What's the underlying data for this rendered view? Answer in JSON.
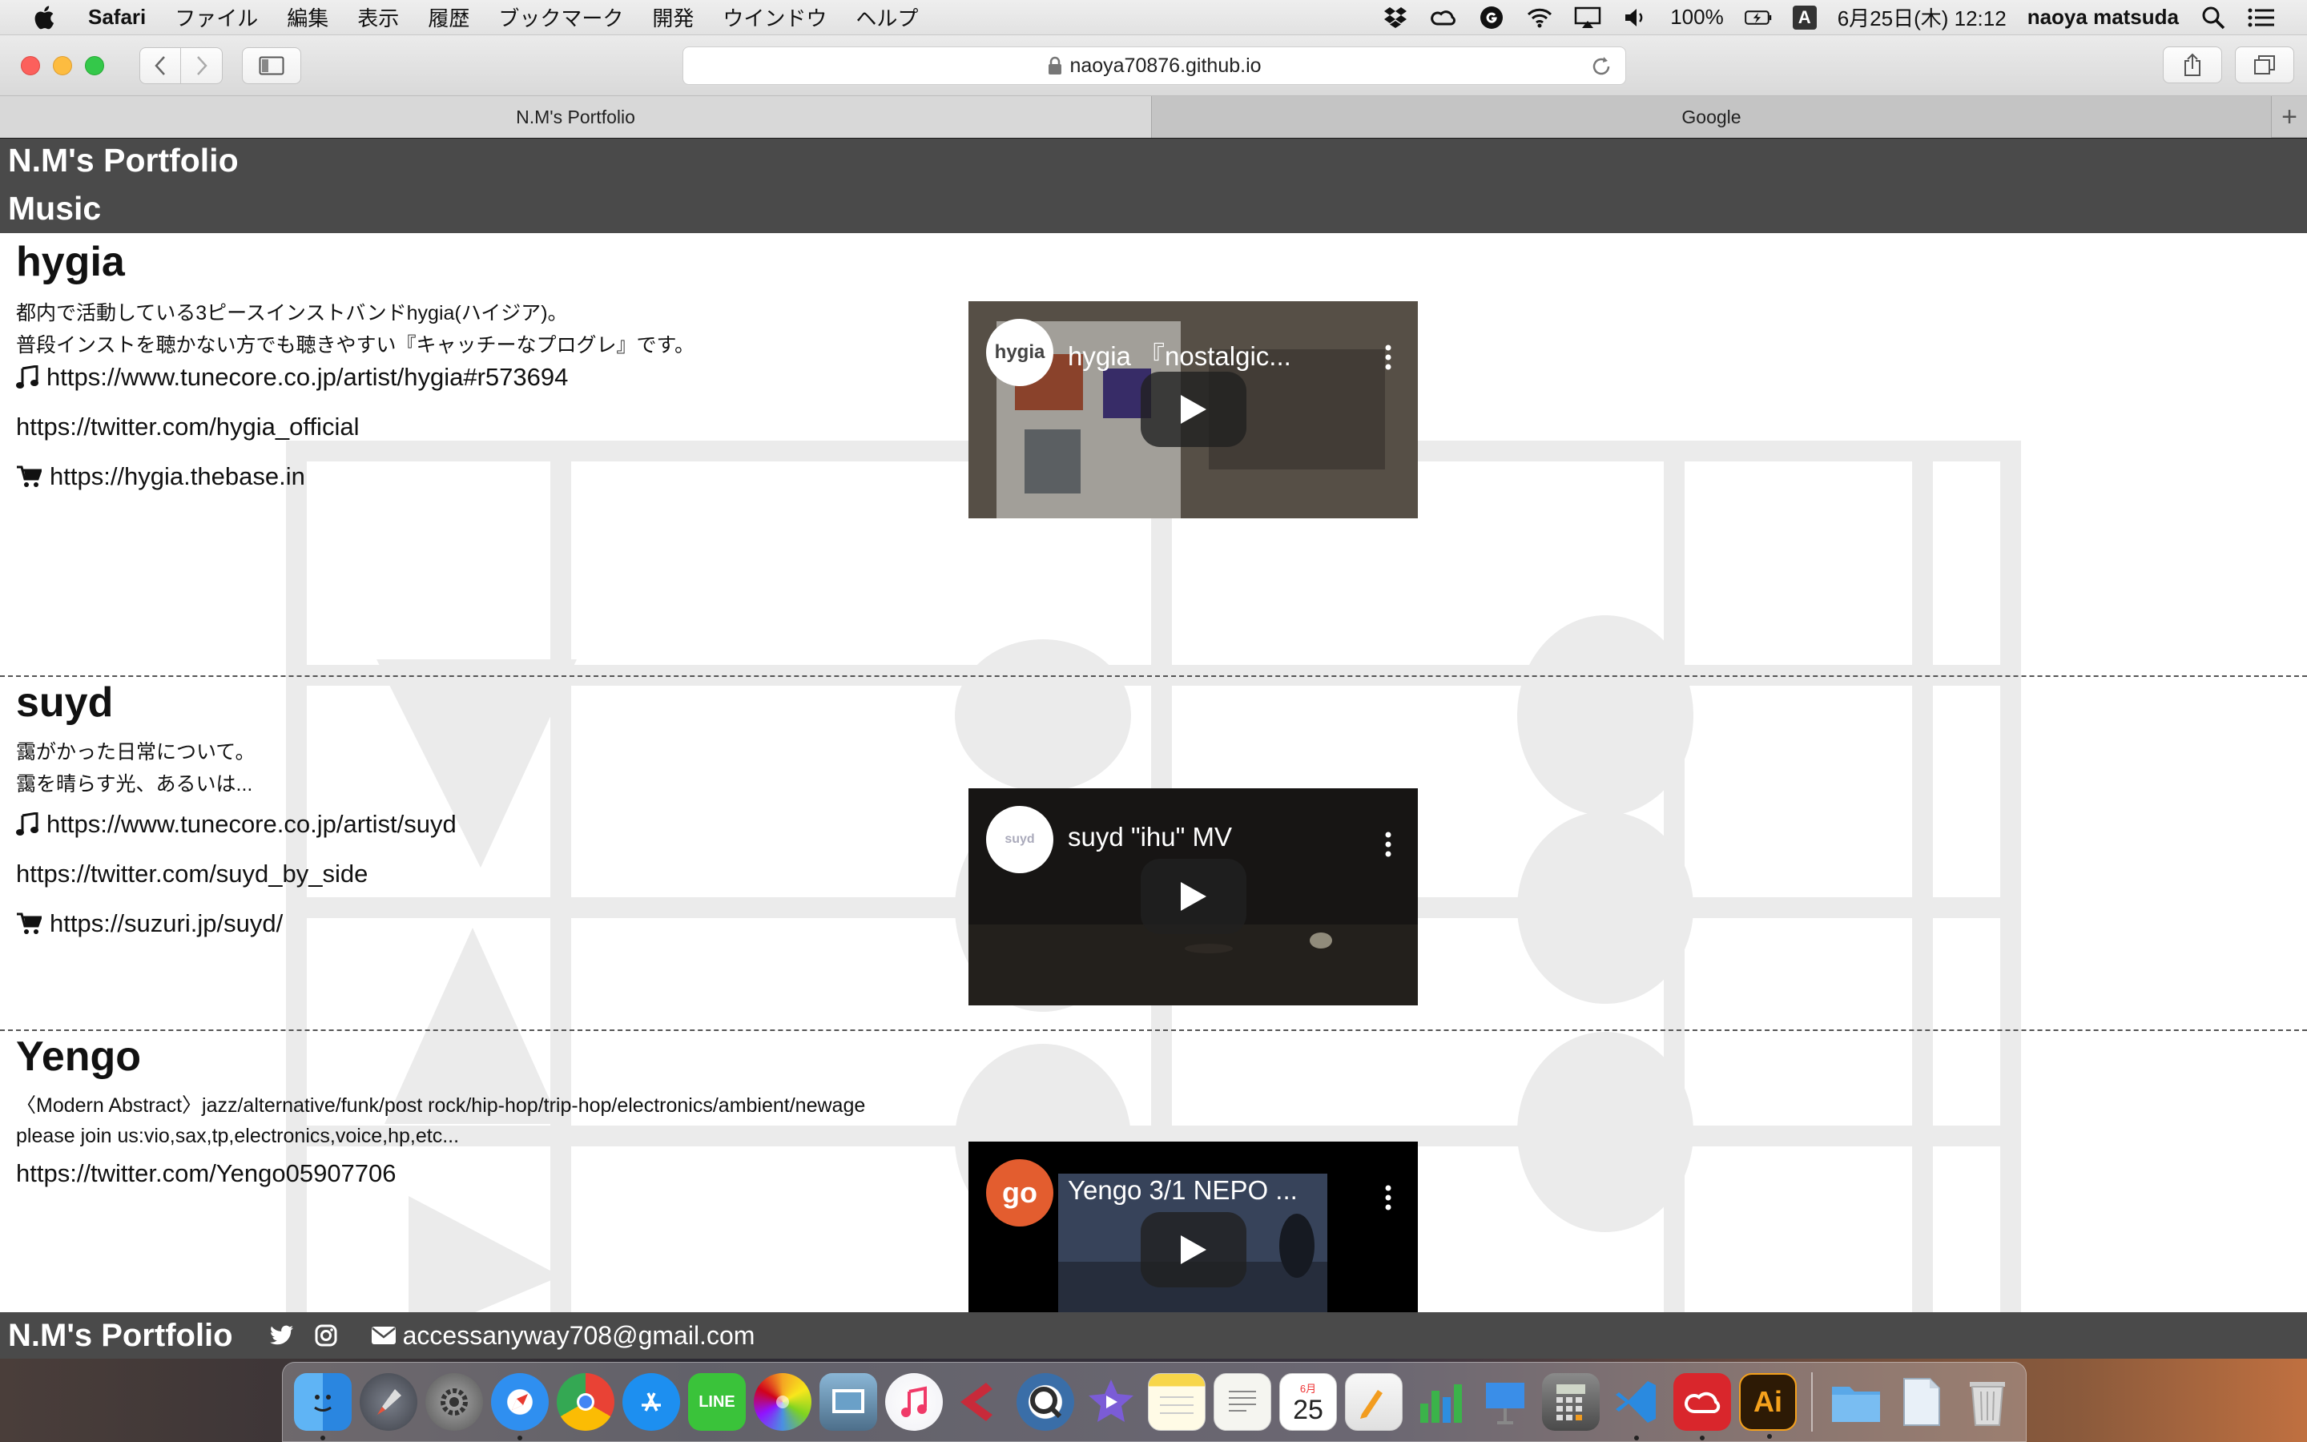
{
  "menubar": {
    "app_name": "Safari",
    "menus": [
      "ファイル",
      "編集",
      "表示",
      "履歴",
      "ブックマーク",
      "開発",
      "ウインドウ",
      "ヘルプ"
    ],
    "battery": "100%",
    "input_mode": "A",
    "datetime": "6月25日(木)  12:12",
    "user": "naoya matsuda"
  },
  "browser": {
    "url": "naoya70876.github.io",
    "tabs": [
      {
        "label": "N.M's Portfolio"
      },
      {
        "label": "Google"
      }
    ],
    "new_tab": "+"
  },
  "site": {
    "brand": "N.M's Portfolio",
    "section": "Music",
    "bands": [
      {
        "name": "hygia",
        "desc1": "都内で活動している3ピースインストバンドhygia(ハイジア)。",
        "desc2": "普段インストを聴かない方でも聴きやすい『キャッチーなプログレ』です。",
        "music_link": "https://www.tunecore.co.jp/artist/hygia#r573694",
        "twitter_link": "https://twitter.com/hygia_official",
        "shop_link": "https://hygia.thebase.in",
        "video_title": "hygia 『nostalgic...",
        "channel_label": "hygia"
      },
      {
        "name": "suyd",
        "desc1": "靄がかった日常について。",
        "desc2": "靄を晴らす光、あるいは...",
        "music_link": "https://www.tunecore.co.jp/artist/suyd",
        "twitter_link": "https://twitter.com/suyd_by_side",
        "shop_link": "https://suzuri.jp/suyd/",
        "video_title": "suyd \"ihu\" MV",
        "channel_label": "suyd"
      },
      {
        "name": "Yengo",
        "desc1": "〈Modern Abstract〉jazz/alternative/funk/post rock/hip-hop/trip-hop/electronics/ambient/newage",
        "desc2": "please join us:vio,sax,tp,electronics,voice,hp,etc...",
        "twitter_link": "https://twitter.com/Yengo05907706",
        "video_title": "Yengo 3/1 NEPO ...",
        "channel_label": "go"
      }
    ],
    "footer": {
      "brand": "N.M's Portfolio",
      "email": "accessanyway708@gmail.com"
    }
  },
  "dock": {
    "calendar_month": "6月",
    "calendar_day": "25",
    "illustrator_label": "Ai",
    "line_label": "LINE"
  },
  "colors": {
    "header_bg": "#4a4a4a",
    "yengo_channel": "#e35d2f"
  }
}
